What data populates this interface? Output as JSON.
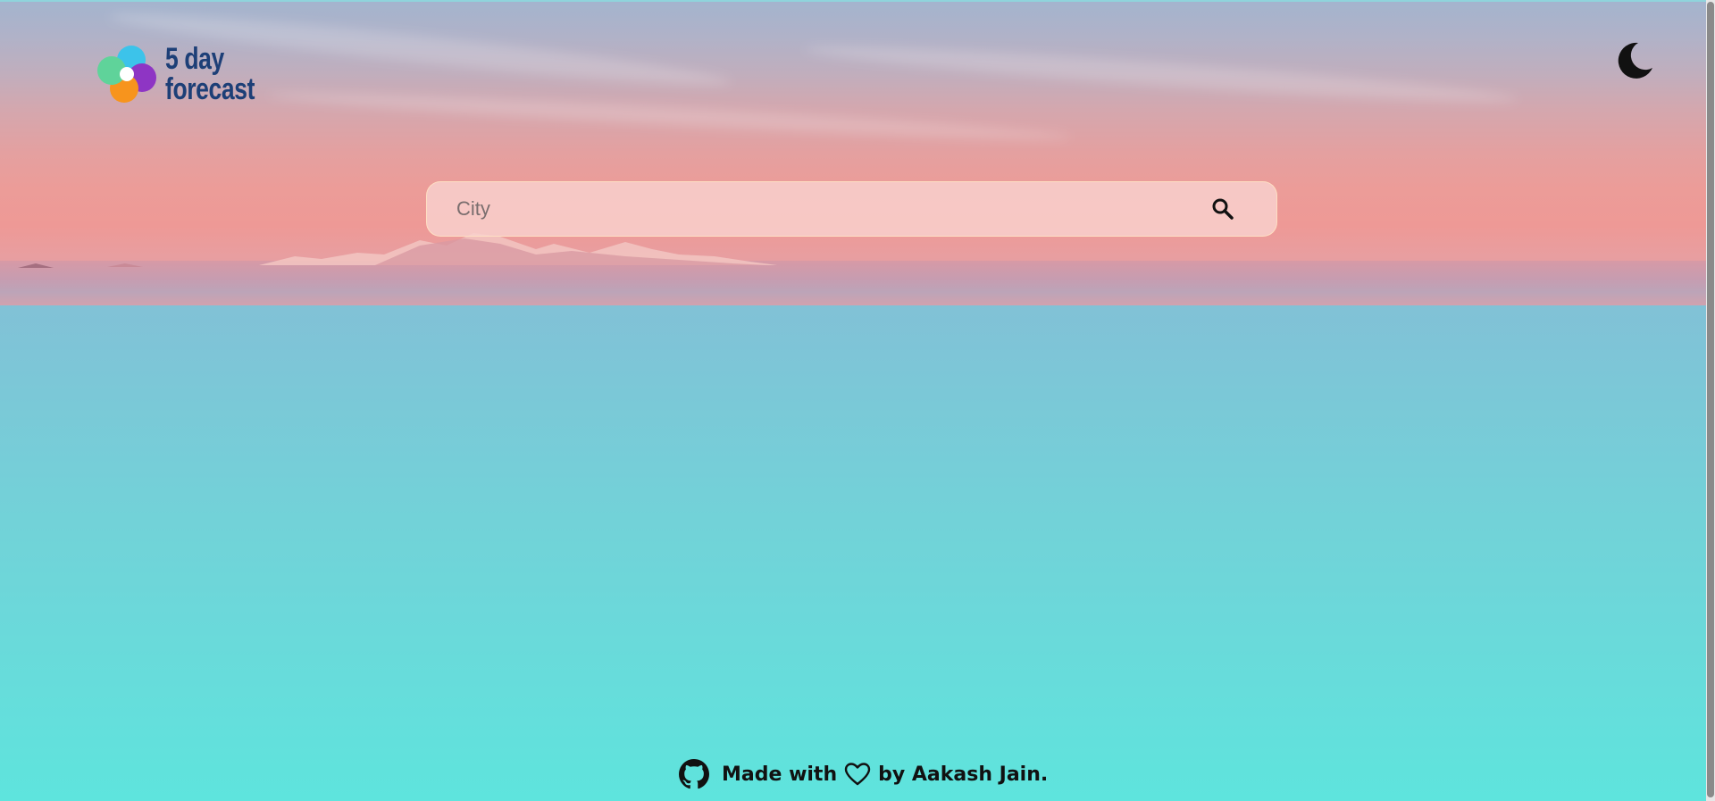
{
  "app": {
    "logo_line1": "5 day",
    "logo_line2": "forecast"
  },
  "icons": {
    "logo": "pinwheel-logo-icon",
    "theme_toggle": "moon-icon",
    "search": "search-icon",
    "github": "github-icon",
    "heart": "heart-outline-icon"
  },
  "search": {
    "placeholder": "City",
    "value": ""
  },
  "footer": {
    "made_with": "Made with",
    "by_author": "by Aakash Jain."
  },
  "colors": {
    "logo_text": "#1d3f77",
    "logo_cyan": "#3cc3ea",
    "logo_purple": "#8e35c4",
    "logo_orange": "#f7941d",
    "logo_green": "#5fd39a",
    "background_top": "#93b1d4",
    "background_bottom": "#5ee4dd"
  }
}
